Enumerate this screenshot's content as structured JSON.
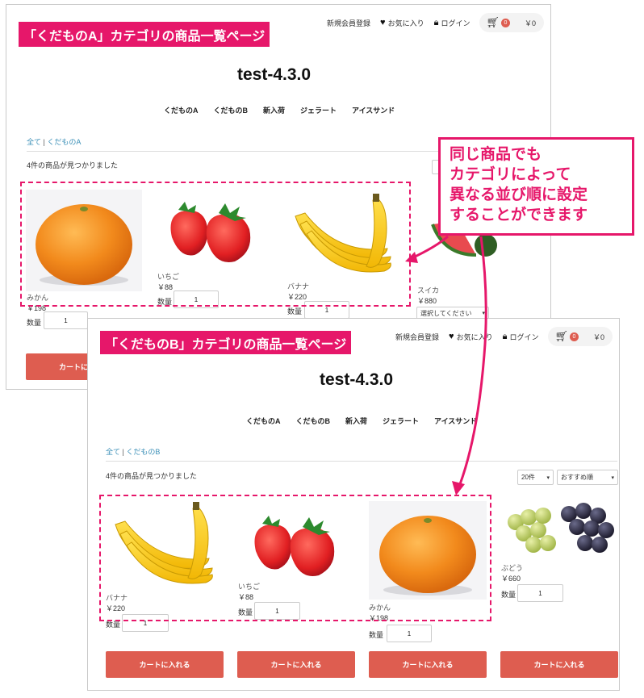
{
  "brand_color": "#e6176a",
  "button_color": "#de5d50",
  "shotA": {
    "label": "「くだものA」カテゴリの商品一覧ページ",
    "header": {
      "register": "新規会員登録",
      "favorites": "お気に入り",
      "login": "ログイン",
      "cart_count": "0",
      "cart_total": "￥0"
    },
    "site_title": "test-4.3.0",
    "nav": [
      "くだものA",
      "くだものB",
      "新入荷",
      "ジェラート",
      "アイスサンド"
    ],
    "breadcrumb": {
      "all": "全て",
      "separator": "|",
      "current": "くだものA"
    },
    "found_text": "4件の商品が見つかりました",
    "sort_select": "",
    "products": [
      {
        "name": "みかん",
        "price": "￥198",
        "qty_label": "数量",
        "qty": "1",
        "image": "mandarin-image"
      },
      {
        "name": "いちご",
        "price": "￥88",
        "qty_label": "数量",
        "qty": "1",
        "image": "strawberry-image"
      },
      {
        "name": "バナナ",
        "price": "￥220",
        "qty_label": "数量",
        "qty": "1",
        "image": "banana-image"
      },
      {
        "name": "スイカ",
        "price": "￥880",
        "qty_label": "数量",
        "qty": "1",
        "image": "watermelon-image",
        "option_select": "選択してください"
      }
    ],
    "cart_button": "カートに入れる"
  },
  "shotB": {
    "label": "「くだものB」カテゴリの商品一覧ページ",
    "header": {
      "register": "新規会員登録",
      "favorites": "お気に入り",
      "login": "ログイン",
      "cart_count": "0",
      "cart_total": "￥0"
    },
    "site_title": "test-4.3.0",
    "nav": [
      "くだものA",
      "くだものB",
      "新入荷",
      "ジェラート",
      "アイスサンド"
    ],
    "breadcrumb": {
      "all": "全て",
      "separator": "|",
      "current": "くだものB"
    },
    "found_text": "4件の商品が見つかりました",
    "per_page_select": "20件",
    "sort_select": "おすすめ順",
    "products": [
      {
        "name": "バナナ",
        "price": "￥220",
        "qty_label": "数量",
        "qty": "1",
        "image": "banana-image"
      },
      {
        "name": "いちご",
        "price": "￥88",
        "qty_label": "数量",
        "qty": "1",
        "image": "strawberry-image"
      },
      {
        "name": "みかん",
        "price": "￥198",
        "qty_label": "数量",
        "qty": "1",
        "image": "mandarin-image"
      },
      {
        "name": "ぶどう",
        "price": "￥660",
        "qty_label": "数量",
        "qty": "1",
        "image": "grape-image"
      }
    ],
    "cart_buttons": [
      "カートに入れる",
      "カートに入れる",
      "カートに入れる",
      "カートに入れる"
    ]
  },
  "callout": {
    "lines": [
      "同じ商品でも",
      "カテゴリによって",
      "異なる並び順に設定",
      "することができます"
    ]
  }
}
